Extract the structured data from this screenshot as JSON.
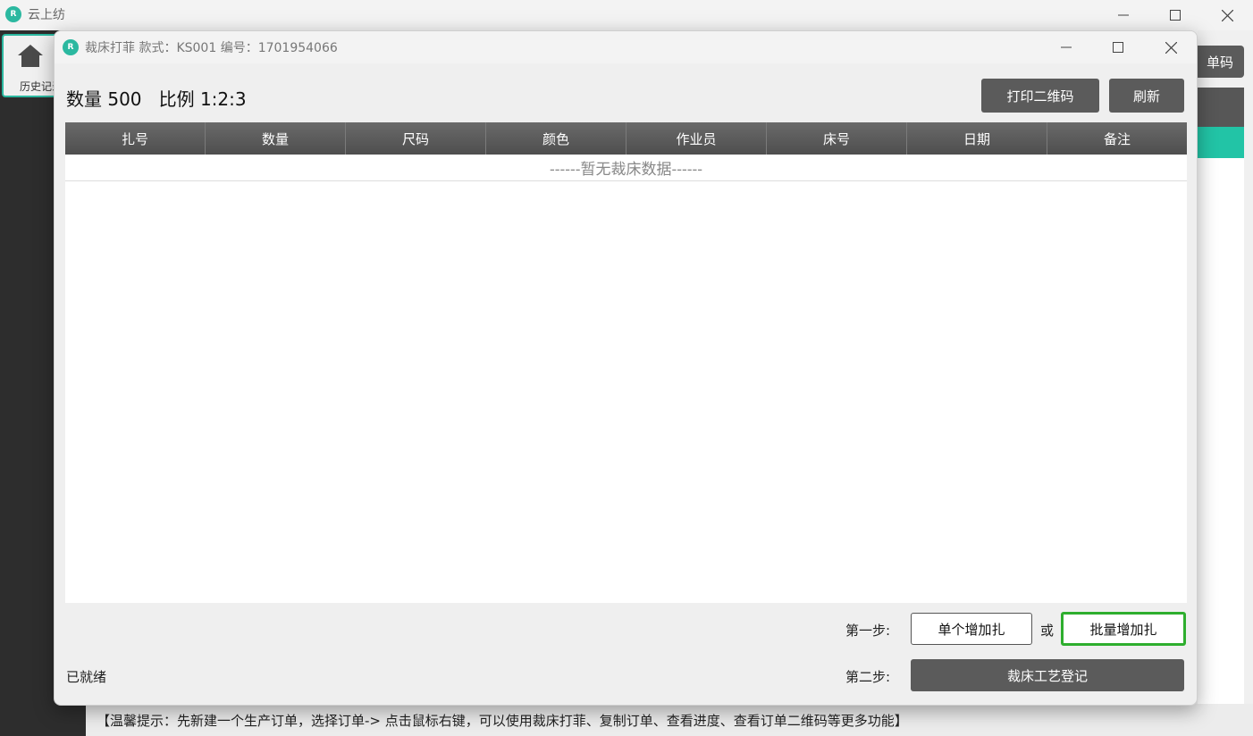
{
  "app": {
    "title": "云上纺",
    "logo_text": "R",
    "sidebar_item_label": "历史记录",
    "right_button_label": "单码",
    "footer_tip": "【温馨提示：先新建一个生产订单，选择订单-> 点击鼠标右键，可以使用裁床打菲、复制订单、查看进度、查看订单二维码等更多功能】"
  },
  "dialog": {
    "title": "裁床打菲   款式：KS001   编号：1701954066",
    "summary": "数量 500   比例 1:2:3",
    "print_qr_label": "打印二维码",
    "refresh_label": "刷新",
    "columns": [
      "扎号",
      "数量",
      "尺码",
      "颜色",
      "作业员",
      "床号",
      "日期",
      "备注"
    ],
    "empty_text": "------暂无裁床数据------",
    "step1_label": "第一步:",
    "add_single_label": "单个增加扎",
    "or_label": "或",
    "add_batch_label": "批量增加扎",
    "step2_label": "第二步:",
    "register_label": "裁床工艺登记",
    "status": "已就绪"
  },
  "colors": {
    "accent": "#2bb8a0",
    "dark_button": "#5b5b5b",
    "highlight_border": "#2eae2e"
  }
}
